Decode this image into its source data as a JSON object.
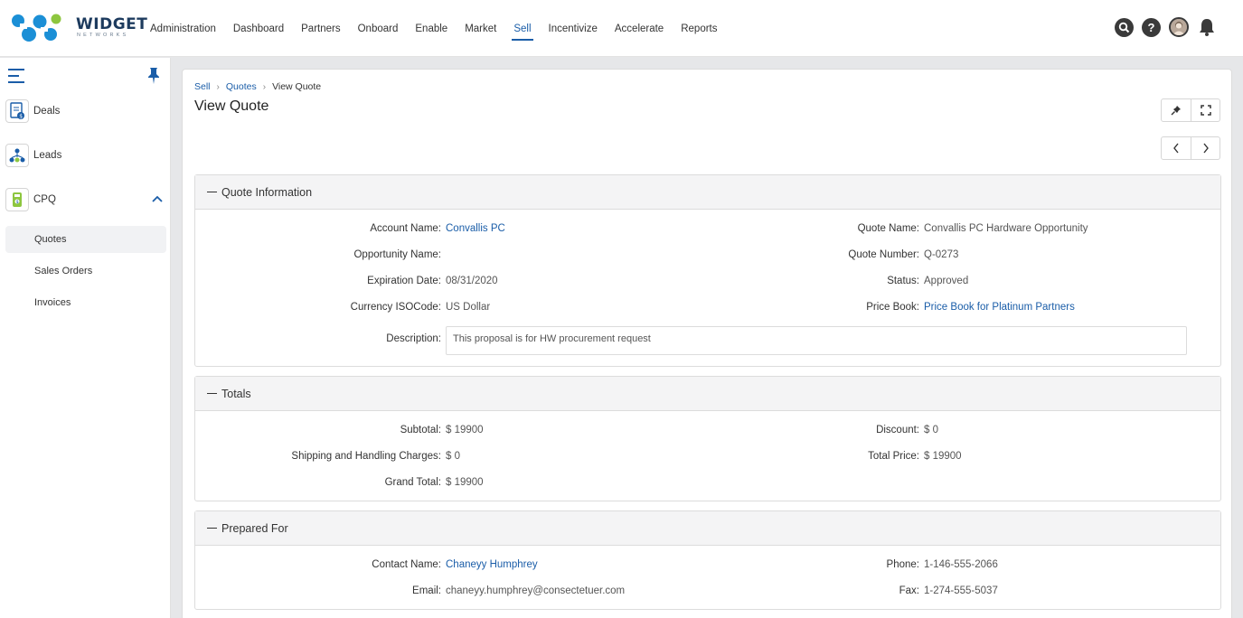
{
  "brand": {
    "name": "WIDGET",
    "tagline": "NETWORKS"
  },
  "nav": [
    {
      "label": "Administration"
    },
    {
      "label": "Dashboard"
    },
    {
      "label": "Partners"
    },
    {
      "label": "Onboard"
    },
    {
      "label": "Enable"
    },
    {
      "label": "Market"
    },
    {
      "label": "Sell",
      "active": true
    },
    {
      "label": "Incentivize"
    },
    {
      "label": "Accelerate"
    },
    {
      "label": "Reports"
    }
  ],
  "sidebar": {
    "items": [
      {
        "label": "Deals",
        "icon": "deals-icon"
      },
      {
        "label": "Leads",
        "icon": "leads-icon"
      },
      {
        "label": "CPQ",
        "icon": "cpq-icon",
        "expanded": true
      }
    ],
    "sub_items": [
      {
        "label": "Quotes",
        "active": true
      },
      {
        "label": "Sales Orders"
      },
      {
        "label": "Invoices"
      }
    ]
  },
  "breadcrumb": {
    "sell": "Sell",
    "quotes": "Quotes",
    "current": "View Quote"
  },
  "page_title": "View Quote",
  "quote_info": {
    "title": "Quote Information",
    "account_name_label": "Account Name:",
    "account_name": "Convallis PC",
    "opportunity_name_label": "Opportunity Name:",
    "opportunity_name": "",
    "expiration_date_label": "Expiration Date:",
    "expiration_date": "08/31/2020",
    "currency_label": "Currency ISOCode:",
    "currency": "US Dollar",
    "description_label": "Description:",
    "description": "This proposal is for HW procurement request",
    "quote_name_label": "Quote Name:",
    "quote_name": "Convallis PC Hardware Opportunity",
    "quote_number_label": "Quote Number:",
    "quote_number": "Q-0273",
    "status_label": "Status:",
    "status": "Approved",
    "price_book_label": "Price Book:",
    "price_book": "Price Book for Platinum Partners"
  },
  "totals": {
    "title": "Totals",
    "subtotal_label": "Subtotal:",
    "subtotal": "$ 19900",
    "shipping_label": "Shipping and Handling Charges:",
    "shipping": "$ 0",
    "grand_total_label": "Grand Total:",
    "grand_total": "$ 19900",
    "discount_label": "Discount:",
    "discount": "$ 0",
    "total_price_label": "Total Price:",
    "total_price": "$ 19900"
  },
  "prepared_for": {
    "title": "Prepared For",
    "contact_name_label": "Contact Name:",
    "contact_name": "Chaneyy Humphrey",
    "email_label": "Email:",
    "email": "chaneyy.humphrey@consectetuer.com",
    "phone_label": "Phone:",
    "phone": "1-146-555-2066",
    "fax_label": "Fax:",
    "fax": "1-274-555-5037"
  },
  "colors": {
    "accent": "#1a5da8",
    "brand_green": "#8dc63f",
    "brand_blue": "#1b8fd6"
  }
}
